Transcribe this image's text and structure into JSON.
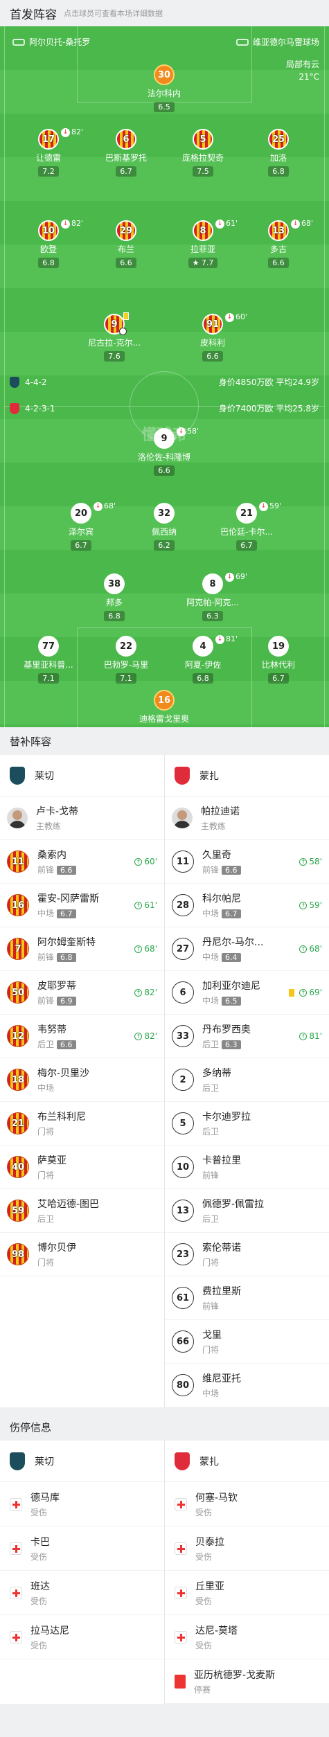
{
  "header": {
    "title": "首发阵容",
    "hint": "点击球员可查看本场详细数据"
  },
  "match": {
    "home_team": "阿尔贝托-桑托罗",
    "away_team": "维亚德尔马雷球场",
    "weather": "局部有云",
    "temperature": "21°C",
    "watermark": "懂球帝"
  },
  "home": {
    "formation": "4-4-2",
    "summary": "身价4850万欧 平均24.9岁",
    "players": [
      {
        "num": "30",
        "name": "法尔科内",
        "rating": "6.5",
        "cap": true
      },
      {
        "num": "17",
        "name": "让德雷",
        "rating": "7.2",
        "event": "82'"
      },
      {
        "num": "6",
        "name": "巴斯基罗托",
        "rating": "6.7"
      },
      {
        "num": "5",
        "name": "庞格拉契奇",
        "rating": "7.5"
      },
      {
        "num": "25",
        "name": "加洛",
        "rating": "6.8"
      },
      {
        "num": "10",
        "name": "欧登",
        "rating": "6.8",
        "event": "82'"
      },
      {
        "num": "29",
        "name": "布兰",
        "rating": "6.6"
      },
      {
        "num": "8",
        "name": "拉菲亚",
        "rating": "7.7",
        "event": "61'",
        "star": true
      },
      {
        "num": "13",
        "name": "多古",
        "rating": "6.6",
        "event": "68'"
      },
      {
        "num": "9",
        "name": "尼古拉-克尔...",
        "rating": "7.6",
        "yellow": true,
        "goal": true
      },
      {
        "num": "91",
        "name": "皮科利",
        "rating": "6.6",
        "event": "60'"
      }
    ]
  },
  "away": {
    "formation": "4-2-3-1",
    "summary": "身价7400万欧 平均25.8岁",
    "players": [
      {
        "num": "9",
        "name": "洛伦佐-科隆博",
        "rating": "6.6",
        "event": "58'"
      },
      {
        "num": "20",
        "name": "泽尔宾",
        "rating": "6.7",
        "event": "68'"
      },
      {
        "num": "32",
        "name": "佩西纳",
        "rating": "6.2"
      },
      {
        "num": "21",
        "name": "巴伦廷-卡尔...",
        "rating": "6.7",
        "event": "59'"
      },
      {
        "num": "38",
        "name": "邦多",
        "rating": "6.8"
      },
      {
        "num": "8",
        "name": "阿克帕-阿克...",
        "rating": "6.3",
        "event": "69'"
      },
      {
        "num": "77",
        "name": "基里亚科普...",
        "rating": "7.1"
      },
      {
        "num": "22",
        "name": "巴勃罗-马里",
        "rating": "7.1"
      },
      {
        "num": "4",
        "name": "阿夏-伊佐",
        "rating": "6.8",
        "event": "81'"
      },
      {
        "num": "19",
        "name": "比林代利",
        "rating": "6.7"
      },
      {
        "num": "16",
        "name": "迪格雷戈里奥",
        "rating": "6.8",
        "cap": true
      }
    ]
  },
  "subs": {
    "title": "替补阵容",
    "home_team": "莱切",
    "away_team": "蒙扎",
    "home_coach": {
      "name": "卢卡-戈蒂",
      "role": "主教练"
    },
    "away_coach": {
      "name": "帕拉迪诺",
      "role": "主教练"
    },
    "home_list": [
      {
        "num": "11",
        "name": "桑索内",
        "pos": "前锋",
        "rating": "6.6",
        "minute": "60'"
      },
      {
        "num": "16",
        "name": "霍安-冈萨雷斯",
        "pos": "中场",
        "rating": "6.7",
        "minute": "61'"
      },
      {
        "num": "7",
        "name": "阿尔姆奎斯特",
        "pos": "前锋",
        "rating": "6.8",
        "minute": "68'"
      },
      {
        "num": "50",
        "name": "皮耶罗蒂",
        "pos": "前锋",
        "rating": "6.9",
        "minute": "82'"
      },
      {
        "num": "12",
        "name": "韦努蒂",
        "pos": "后卫",
        "rating": "6.6",
        "minute": "82'"
      },
      {
        "num": "18",
        "name": "梅尔-贝里沙",
        "pos": "中场"
      },
      {
        "num": "21",
        "name": "布兰科利尼",
        "pos": "门将"
      },
      {
        "num": "40",
        "name": "萨莫亚",
        "pos": "门将"
      },
      {
        "num": "59",
        "name": "艾哈迈德-图巴",
        "pos": "后卫"
      },
      {
        "num": "98",
        "name": "博尔贝伊",
        "pos": "门将"
      }
    ],
    "away_list": [
      {
        "num": "11",
        "name": "久里奇",
        "pos": "前锋",
        "rating": "6.6",
        "minute": "58'"
      },
      {
        "num": "28",
        "name": "科尔帕尼",
        "pos": "中场",
        "rating": "6.7",
        "minute": "59'"
      },
      {
        "num": "27",
        "name": "丹尼尔-马尔...",
        "pos": "中场",
        "rating": "6.4",
        "minute": "68'"
      },
      {
        "num": "6",
        "name": "加利亚尔迪尼",
        "pos": "中场",
        "rating": "6.5",
        "minute": "69'",
        "yellow": true
      },
      {
        "num": "33",
        "name": "丹布罗西奥",
        "pos": "后卫",
        "rating": "6.3",
        "minute": "81'"
      },
      {
        "num": "2",
        "name": "多纳蒂",
        "pos": "后卫"
      },
      {
        "num": "5",
        "name": "卡尔迪罗拉",
        "pos": "后卫"
      },
      {
        "num": "10",
        "name": "卡普拉里",
        "pos": "前锋"
      },
      {
        "num": "13",
        "name": "佩德罗-佩雷拉",
        "pos": "后卫"
      },
      {
        "num": "23",
        "name": "索伦蒂诺",
        "pos": "门将"
      },
      {
        "num": "61",
        "name": "费拉里斯",
        "pos": "前锋"
      },
      {
        "num": "66",
        "name": "戈里",
        "pos": "门将"
      },
      {
        "num": "80",
        "name": "维尼亚托",
        "pos": "中场"
      }
    ]
  },
  "injuries": {
    "title": "伤停信息",
    "home_team": "莱切",
    "away_team": "蒙扎",
    "home_list": [
      {
        "name": "德马库",
        "status": "受伤"
      },
      {
        "name": "卡巴",
        "status": "受伤"
      },
      {
        "name": "班达",
        "status": "受伤"
      },
      {
        "name": "拉马达尼",
        "status": "受伤"
      }
    ],
    "away_list": [
      {
        "name": "何塞-马钦",
        "status": "受伤"
      },
      {
        "name": "贝泰拉",
        "status": "受伤"
      },
      {
        "name": "丘里亚",
        "status": "受伤"
      },
      {
        "name": "达尼-莫塔",
        "status": "受伤"
      },
      {
        "name": "亚历杭德罗-戈麦斯",
        "status": "停赛",
        "red": true
      }
    ]
  }
}
